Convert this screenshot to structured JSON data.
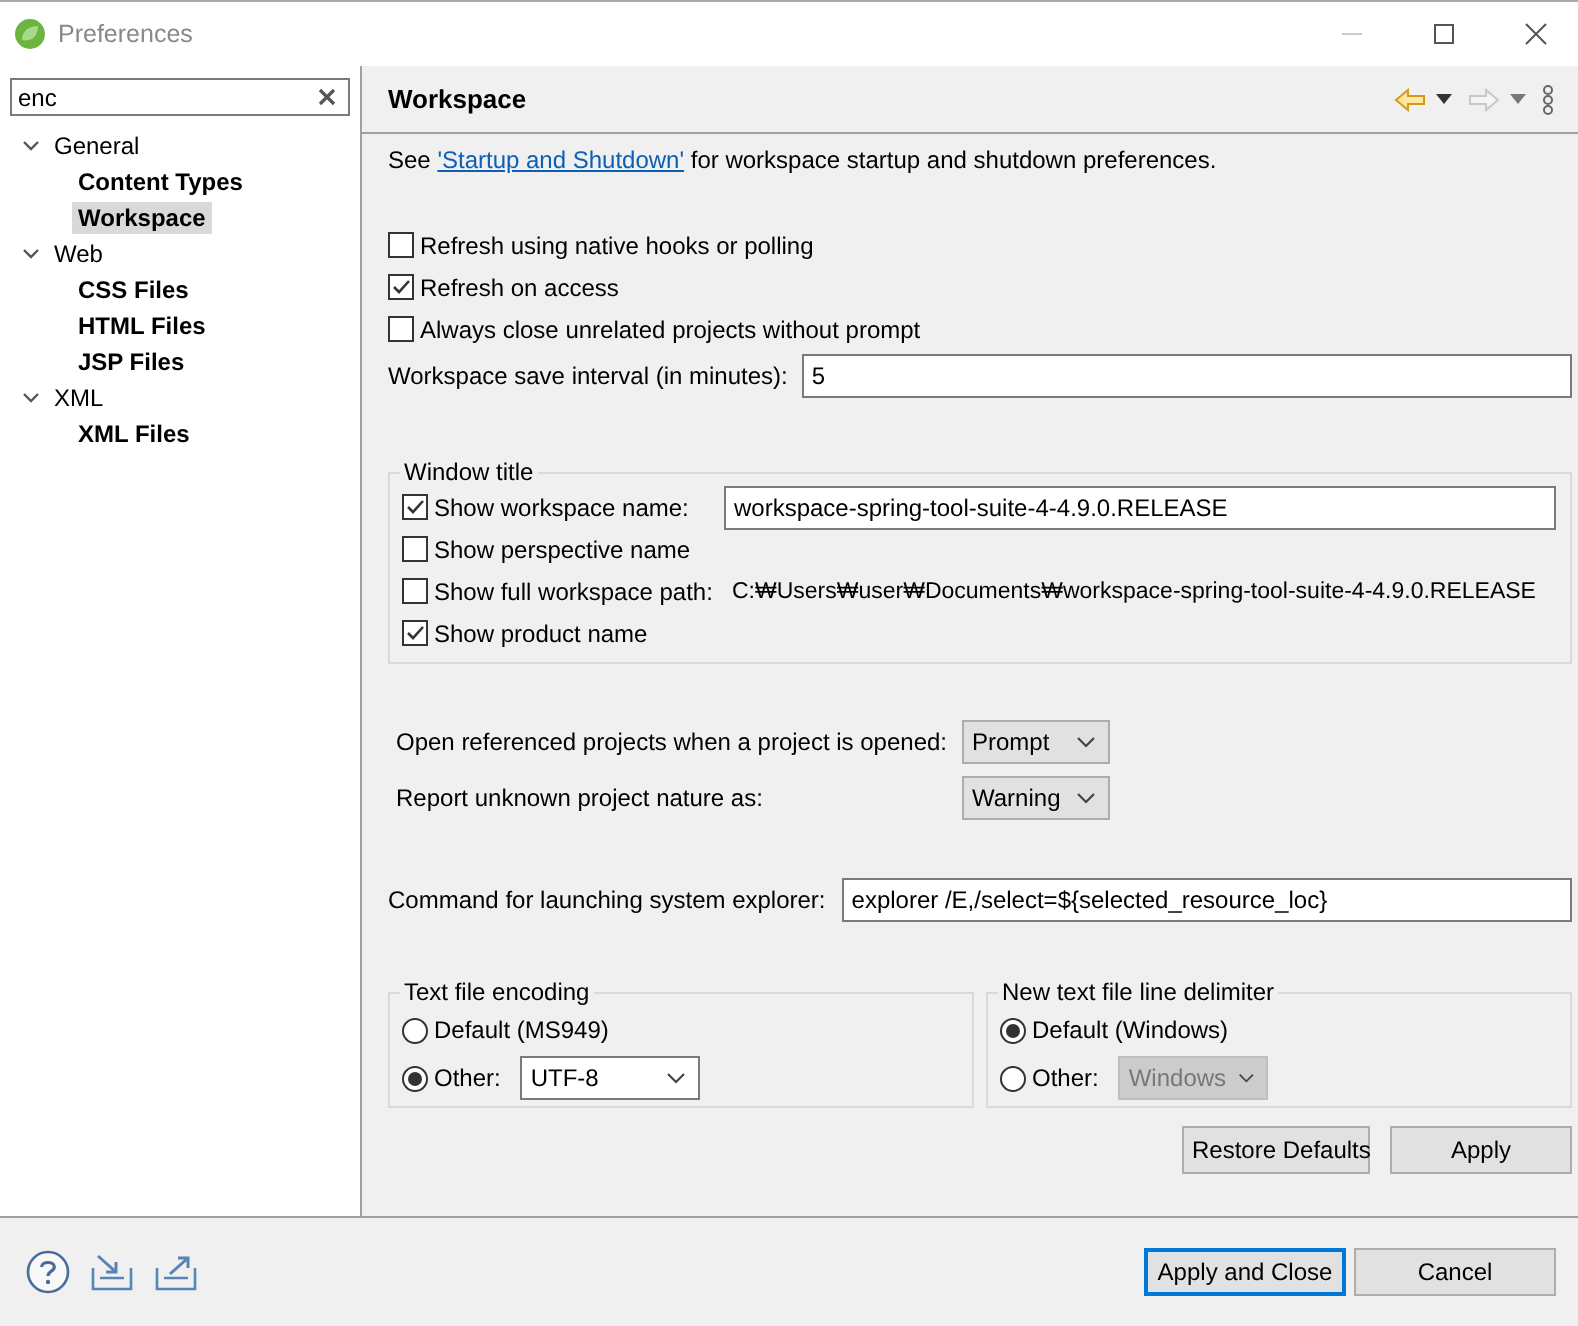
{
  "window": {
    "title": "Preferences"
  },
  "filter": {
    "value": "enc"
  },
  "tree": [
    {
      "label": "General",
      "expanded": true,
      "selected": false,
      "children": [
        {
          "label": "Content Types",
          "selected": false
        },
        {
          "label": "Workspace",
          "selected": true
        }
      ]
    },
    {
      "label": "Web",
      "expanded": true,
      "selected": false,
      "children": [
        {
          "label": "CSS Files",
          "selected": false
        },
        {
          "label": "HTML Files",
          "selected": false
        },
        {
          "label": "JSP Files",
          "selected": false
        }
      ]
    },
    {
      "label": "XML",
      "expanded": true,
      "selected": false,
      "children": [
        {
          "label": "XML Files",
          "selected": false
        }
      ]
    }
  ],
  "page": {
    "title": "Workspace",
    "intro": {
      "before": "See ",
      "link": "'Startup and Shutdown'",
      "after": " for workspace startup and shutdown preferences."
    },
    "nav": {
      "back_enabled": true,
      "forward_enabled": false
    }
  },
  "options": [
    {
      "label": "Refresh using native hooks or polling",
      "checked": false
    },
    {
      "label": "Refresh on access",
      "checked": true
    },
    {
      "label": "Always close unrelated projects without prompt",
      "checked": false
    }
  ],
  "save_interval": {
    "label": "Workspace save interval (in minutes):",
    "value": "5"
  },
  "window_title": {
    "title": "Window title",
    "options": [
      {
        "kind": "field",
        "label": "Show workspace name:",
        "checked": true,
        "value": "workspace-spring-tool-suite-4-4.9.0.RELEASE"
      },
      {
        "kind": "plain",
        "label": "Show perspective name",
        "checked": false
      },
      {
        "kind": "path",
        "label": "Show full workspace path:",
        "checked": false,
        "value": "C:₩Users₩user₩Documents₩workspace-spring-tool-suite-4-4.9.0.RELEASE"
      },
      {
        "kind": "plain",
        "label": "Show product name",
        "checked": true
      }
    ]
  },
  "choices": [
    {
      "label": "Open referenced projects when a project is opened:",
      "value": "Prompt"
    },
    {
      "label": "Report unknown project nature as:",
      "value": "Warning"
    }
  ],
  "explorer": {
    "label": "Command for launching system explorer:",
    "value": "explorer /E,/select=${selected_resource_loc}"
  },
  "groups": [
    {
      "title": "Text file encoding",
      "options": [
        {
          "label": "Default (MS949)",
          "selected": false
        },
        {
          "label": "Other:",
          "selected": true,
          "combo": {
            "value": "UTF-8",
            "disabled": false
          }
        }
      ]
    },
    {
      "title": "New text file line delimiter",
      "options": [
        {
          "label": "Default (Windows)",
          "selected": true
        },
        {
          "label": "Other:",
          "selected": false,
          "combo": {
            "value": "Windows",
            "disabled": true
          }
        }
      ]
    }
  ],
  "page_buttons": [
    "Restore Defaults",
    "Apply"
  ],
  "footer_buttons": [
    {
      "label": "Apply and Close",
      "default": true
    },
    {
      "label": "Cancel",
      "default": false
    }
  ]
}
